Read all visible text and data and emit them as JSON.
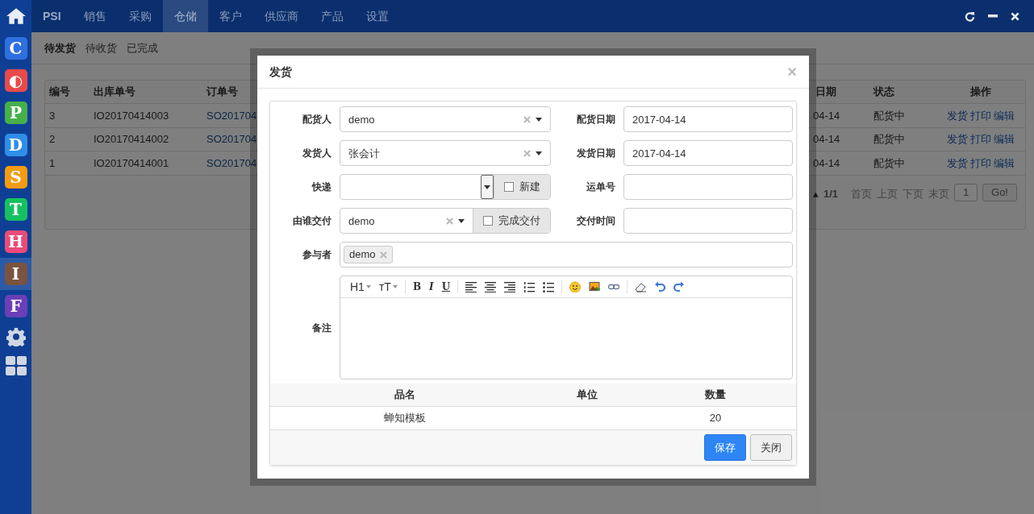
{
  "brand": "PSI",
  "nav_tabs": [
    {
      "label": "销售",
      "selected": false
    },
    {
      "label": "采购",
      "selected": false
    },
    {
      "label": "仓储",
      "selected": true
    },
    {
      "label": "客户",
      "selected": false
    },
    {
      "label": "供应商",
      "selected": false
    },
    {
      "label": "产品",
      "selected": false
    },
    {
      "label": "设置",
      "selected": false
    }
  ],
  "apps": [
    {
      "letter": "C",
      "color": "#2f6fe0",
      "selected": false
    },
    {
      "letter": "◐",
      "color": "#e84a4a",
      "selected": false
    },
    {
      "letter": "P",
      "color": "#47b04b",
      "selected": false
    },
    {
      "letter": "D",
      "color": "#2f8ee8",
      "selected": false
    },
    {
      "letter": "S",
      "color": "#f59b10",
      "selected": false
    },
    {
      "letter": "T",
      "color": "#16c060",
      "selected": false
    },
    {
      "letter": "H",
      "color": "#e94b7a",
      "selected": false
    },
    {
      "letter": "I",
      "color": "#7a5440",
      "selected": true
    },
    {
      "letter": "F",
      "color": "#6a3fb8",
      "selected": false
    }
  ],
  "sub_tabs": [
    {
      "label": "待发货",
      "selected": true
    },
    {
      "label": "待收货",
      "selected": false
    },
    {
      "label": "已完成",
      "selected": false
    }
  ],
  "table": {
    "columns": [
      "编号",
      "出库单号",
      "订单号",
      "日期",
      "状态",
      "操作"
    ],
    "rows": [
      {
        "id": "3",
        "out_no": "IO20170414003",
        "order_no": "SO201704",
        "date": "04-14",
        "status": "配货中",
        "actions": [
          "发货",
          "打印",
          "编辑"
        ]
      },
      {
        "id": "2",
        "out_no": "IO20170414002",
        "order_no": "SO201704",
        "date": "04-14",
        "status": "配货中",
        "actions": [
          "发货",
          "打印",
          "编辑"
        ]
      },
      {
        "id": "1",
        "out_no": "IO20170414001",
        "order_no": "SO201704",
        "date": "04-14",
        "status": "配货中",
        "actions": [
          "发货",
          "打印",
          "编辑"
        ]
      }
    ],
    "pager": {
      "per_page": "▴",
      "pages": "1/1",
      "links": [
        "首页",
        "上页",
        "下页",
        "末页"
      ],
      "page": "1",
      "go": "Go!"
    }
  },
  "dialog": {
    "title": "发货",
    "close": "×",
    "fields": [
      {
        "label": "配货人",
        "kind": "select",
        "value": "demo"
      },
      {
        "label": "配货日期",
        "kind": "input",
        "value": "2017-04-14"
      },
      {
        "label": "发货人",
        "kind": "select",
        "value": "张会计"
      },
      {
        "label": "发货日期",
        "kind": "input",
        "value": "2017-04-14"
      },
      {
        "label": "快递",
        "kind": "combo",
        "addon": {
          "label": "新建",
          "checked": false
        }
      },
      {
        "label": "运单号",
        "kind": "input"
      },
      {
        "label": "由谁交付",
        "kind": "select",
        "value": "demo",
        "addon": {
          "label": "完成交付",
          "checked": false
        }
      },
      {
        "label": "交付时间",
        "kind": "input"
      },
      {
        "label": "参与者",
        "kind": "tags",
        "tags": [
          "demo"
        ]
      },
      {
        "label": "备注",
        "kind": "editor",
        "toolbar_text": [
          [
            "H1",
            "ᴛT"
          ],
          [
            "B",
            "I",
            "U"
          ]
        ]
      }
    ],
    "items": {
      "columns": [
        "品名",
        "单位",
        "数量"
      ],
      "rows": [
        {
          "name": "蝉知模板",
          "quantity": "20"
        }
      ]
    },
    "buttons": [
      {
        "label": "保存",
        "kind": "primary"
      },
      {
        "label": "关闭",
        "kind": "default"
      }
    ]
  }
}
